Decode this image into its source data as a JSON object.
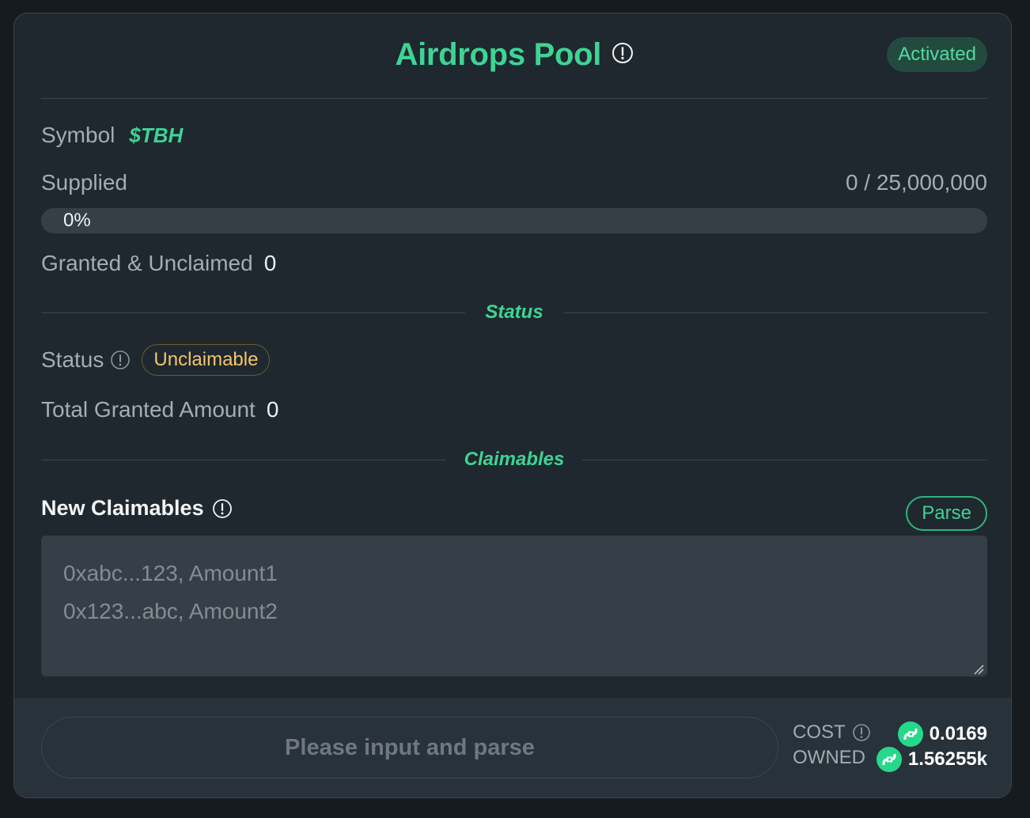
{
  "header": {
    "title": "Airdrops Pool",
    "badge": "Activated"
  },
  "symbol": {
    "label": "Symbol",
    "value": "$TBH"
  },
  "supplied": {
    "label": "Supplied",
    "value": "0 / 25,000,000",
    "progress_text": "0%",
    "progress_fraction": 0
  },
  "granted_unclaimed": {
    "label": "Granted & Unclaimed",
    "value": "0"
  },
  "status_section": {
    "title": "Status"
  },
  "status": {
    "label": "Status",
    "value": "Unclaimable"
  },
  "total_granted": {
    "label": "Total Granted Amount",
    "value": "0"
  },
  "claimables_section": {
    "title": "Claimables"
  },
  "new_claimables": {
    "label": "New Claimables",
    "parse_label": "Parse",
    "placeholder": "0xabc...123, Amount1\n0x123...abc, Amount2"
  },
  "footer": {
    "action_label": "Please input and parse",
    "cost_label": "COST",
    "cost_value": "0.0169",
    "owned_label": "OWNED",
    "owned_value": "1.56255k"
  },
  "colors": {
    "accent": "#3ed494",
    "warning": "#f2c56a",
    "background": "#1f282e"
  },
  "icons": {
    "info": "info-circle-icon",
    "coin": "flow-coin-icon"
  }
}
